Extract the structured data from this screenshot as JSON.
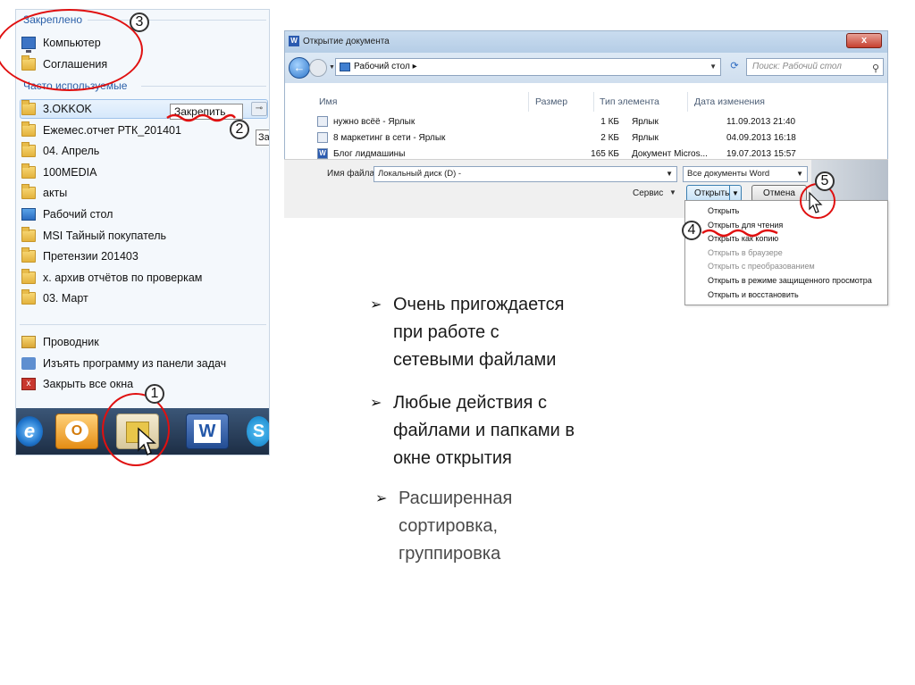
{
  "jumplist": {
    "pinned_header": "Закреплено",
    "frequent_header": "Часто используемые",
    "pinned_items": [
      {
        "label": "Компьютер",
        "icon": "computer-icon"
      },
      {
        "label": "Соглашения",
        "icon": "folder-icon"
      }
    ],
    "frequent_items": [
      {
        "label": "3.OKKOK",
        "icon": "folder-icon"
      },
      {
        "label": "Ежемес.отчет РТК_201401",
        "icon": "folder-icon"
      },
      {
        "label": "04. Апрель",
        "icon": "folder-icon"
      },
      {
        "label": "100MEDIA",
        "icon": "folder-icon"
      },
      {
        "label": "акты",
        "icon": "folder-icon"
      },
      {
        "label": "Рабочий стол",
        "icon": "desktop-icon"
      },
      {
        "label": "MSI Тайный покупатель",
        "icon": "folder-icon"
      },
      {
        "label": "Претензии 201403",
        "icon": "folder-icon"
      },
      {
        "label": "х. архив отчётов по проверкам",
        "icon": "folder-icon"
      },
      {
        "label": "03. Март",
        "icon": "folder-icon"
      }
    ],
    "pin_tooltip": "Закрепить",
    "pin_tooltip_partial": "За",
    "tasks": [
      {
        "label": "Проводник",
        "icon": "explorer-icon"
      },
      {
        "label": "Изъять программу из панели задач",
        "icon": "unpin-icon"
      },
      {
        "label": "Закрыть все окна",
        "icon": "close-window-icon"
      }
    ]
  },
  "taskbar": {
    "ie": "e",
    "outlook": "O",
    "word": "W",
    "skype": "S"
  },
  "dialog": {
    "title": "Открытие документа",
    "title_icon": "W",
    "close": "x",
    "nav_back": "←",
    "address": "Рабочий стол",
    "address_chevron": "▸",
    "refresh": "⟳",
    "search_placeholder": "Поиск: Рабочий стол",
    "columns": {
      "name": "Имя",
      "size": "Размер",
      "type": "Тип элемента",
      "modified": "Дата изменения"
    },
    "files": [
      {
        "name": "нужно всёё - Ярлык",
        "size": "1 КБ",
        "type": "Ярлык",
        "modified": "11.09.2013 21:40"
      },
      {
        "name": "8 маркетинг в сети - Ярлык",
        "size": "2 КБ",
        "type": "Ярлык",
        "modified": "04.09.2013 16:18"
      },
      {
        "name": "Блог лидмашины",
        "size": "165 КБ",
        "type": "Документ Micros...",
        "modified": "19.07.2013 15:57"
      }
    ],
    "filename_label": "Имя файла:",
    "filename_value": "Локальный диск (D) -",
    "filetype_value": "Все документы Word",
    "tools_label": "Сервис",
    "open_button": "Открыть",
    "cancel_button": "Отмена",
    "open_menu": [
      {
        "label": "Открыть",
        "enabled": true
      },
      {
        "label": "Открыть для чтения",
        "enabled": true
      },
      {
        "label": "Открыть как копию",
        "enabled": true
      },
      {
        "label": "Открыть в браузере",
        "enabled": false
      },
      {
        "label": "Открыть с преобразованием",
        "enabled": false
      },
      {
        "label": "Открыть в режиме защищенного просмотра",
        "enabled": true
      },
      {
        "label": "Открыть и восстановить",
        "enabled": true
      }
    ]
  },
  "annotations": {
    "step1": "1",
    "step2": "2",
    "step3": "3",
    "step4": "4",
    "step5": "5",
    "color": "#e01010"
  },
  "bullets": [
    {
      "marker": "➢",
      "lines": [
        "Очень пригождается",
        "при работе с",
        "сетевыми файлами"
      ]
    },
    {
      "marker": "➢",
      "lines": [
        "Любые действия с",
        "файлами и папками в",
        "окне открытия"
      ]
    },
    {
      "marker": "➢",
      "lines": [
        "Расширенная",
        "сортировка,",
        "группировка"
      ]
    }
  ]
}
